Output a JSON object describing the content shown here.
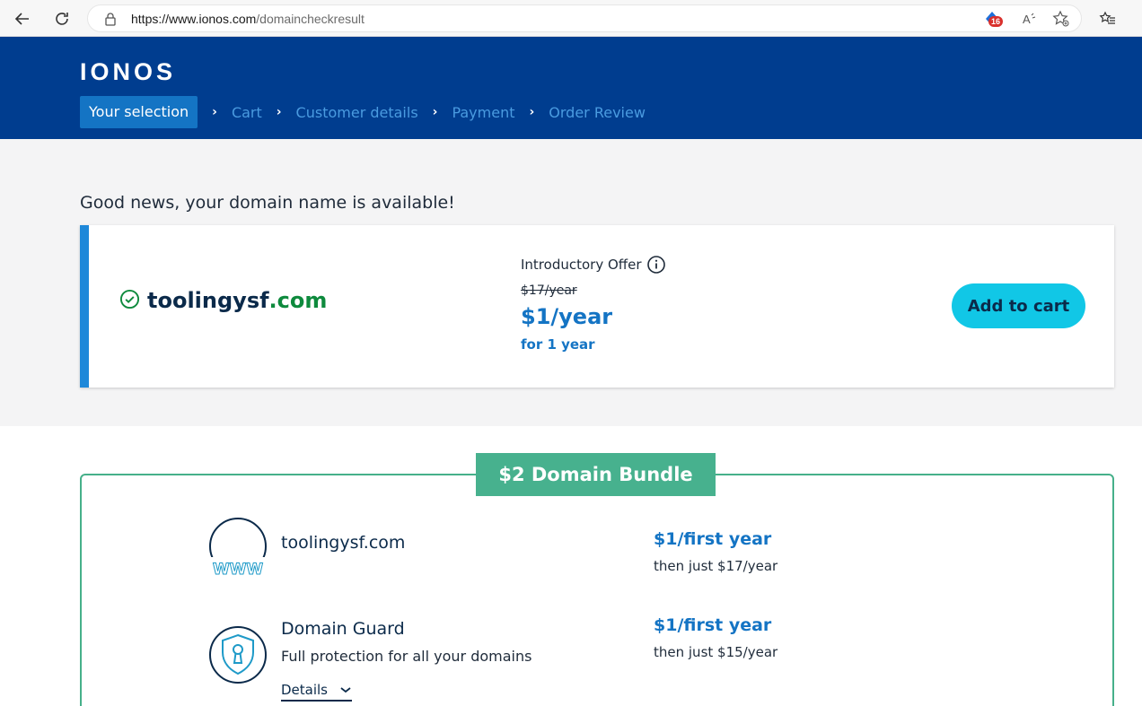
{
  "browser": {
    "url_host": "https://www.ionos.com",
    "url_path": "/domaincheckresult",
    "badge_count": "16"
  },
  "header": {
    "logo": "IONOS",
    "steps": [
      "Your selection",
      "Cart",
      "Customer details",
      "Payment",
      "Order Review"
    ]
  },
  "result": {
    "headline": "Good news, your domain name is available!",
    "domain_name": "toolingysf",
    "domain_tld": ".com",
    "offer_label": "Introductory Offer",
    "old_price": "$17/year",
    "price": "$1/year",
    "term": "for 1 year",
    "add_to_cart": "Add to cart"
  },
  "bundle": {
    "title": "$2 Domain Bundle",
    "items": [
      {
        "title": "toolingysf.com",
        "price": "$1/first year",
        "then": "then just $17/year"
      },
      {
        "title": "Domain Guard",
        "subtitle": "Full protection for all your domains",
        "price": "$1/first year",
        "then": "then just $15/year",
        "details": "Details"
      }
    ]
  },
  "colors": {
    "header_bg": "#003d8f",
    "accent_blue": "#1474c4",
    "cta": "#11c7e6",
    "bundle_green": "#47b18e",
    "available_green": "#0e8a3d"
  },
  "icons": [
    "back-arrow-icon",
    "refresh-icon",
    "lock-icon",
    "extension-icon",
    "read-aloud-icon",
    "add-favorite-icon",
    "favorites-icon",
    "check-circle-icon",
    "info-icon",
    "www-globe-icon",
    "shield-lock-icon",
    "chevron-down-icon"
  ]
}
